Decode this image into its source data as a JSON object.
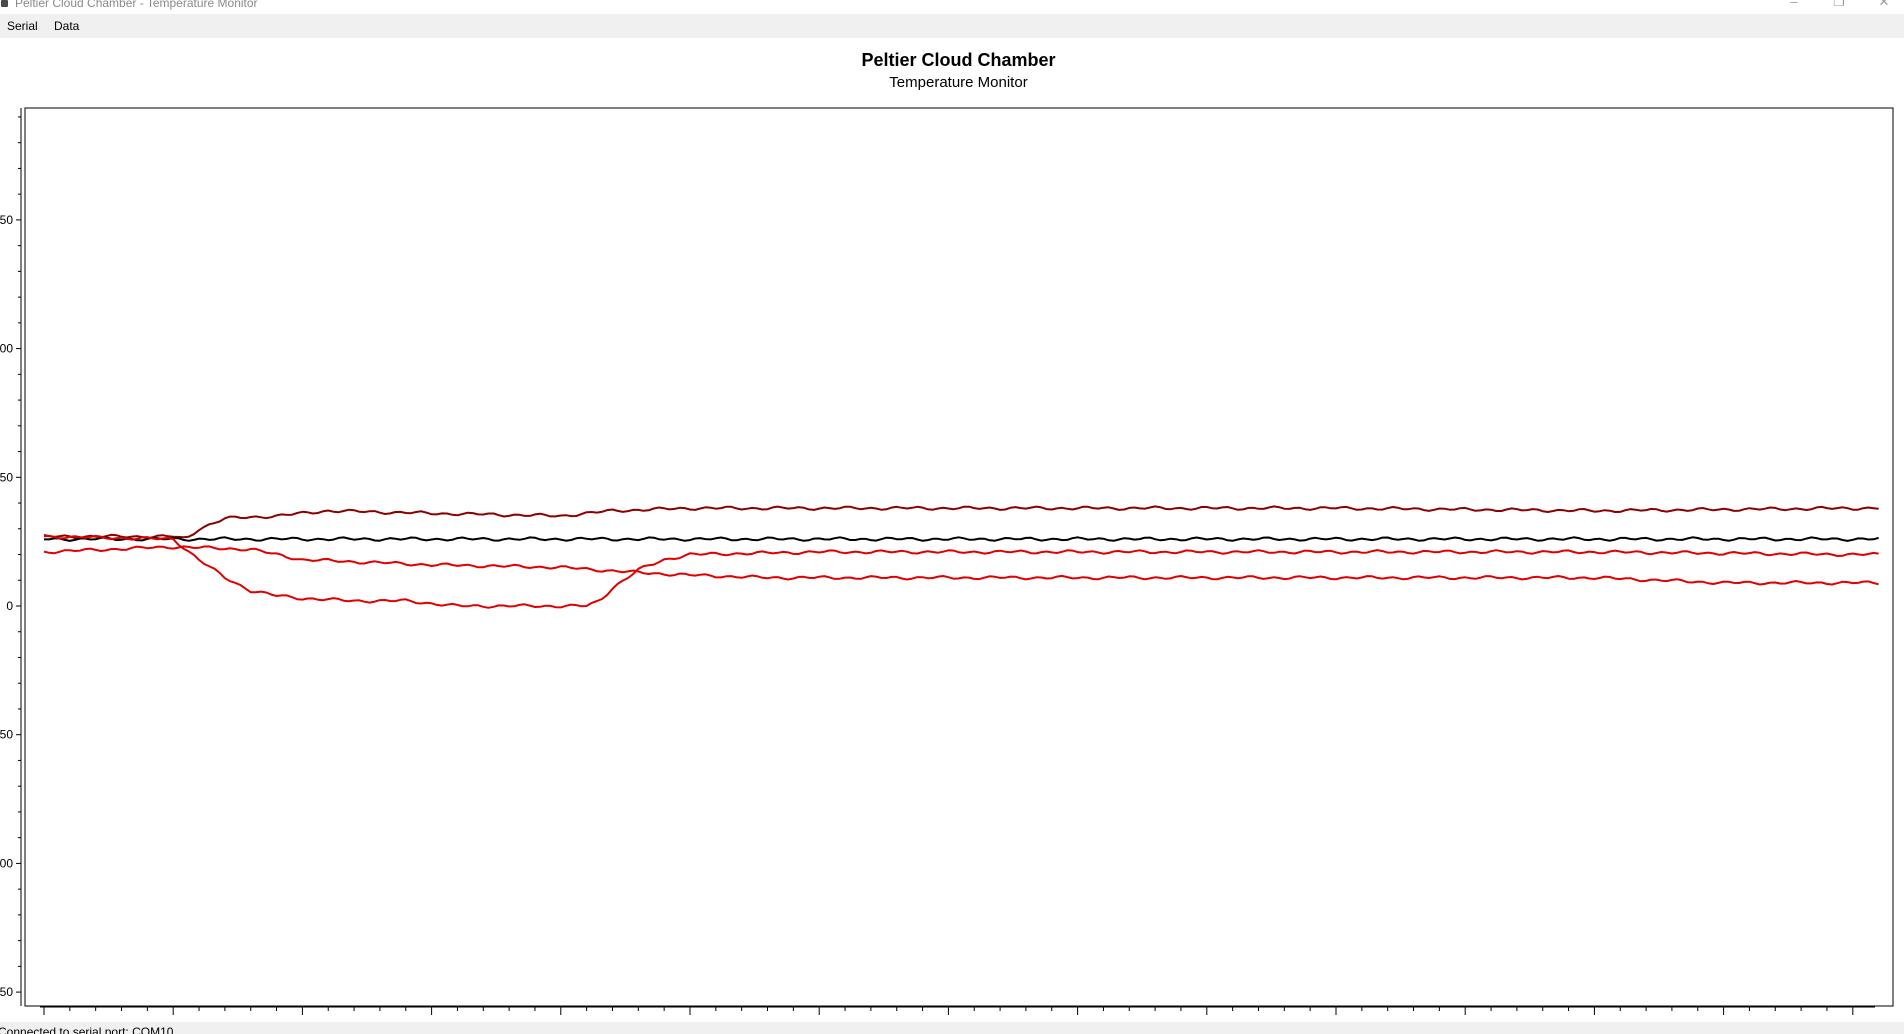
{
  "window": {
    "title": "Peltier Cloud Chamber - Temperature Monitor",
    "minimize_glyph": "–",
    "maximize_glyph": "❐",
    "close_glyph": "✕"
  },
  "menu": {
    "items": [
      {
        "label": "Serial"
      },
      {
        "label": "Data"
      }
    ]
  },
  "status": {
    "text": "Connected to serial port: COM10"
  },
  "colors": {
    "series_dark_red": "#8b0000",
    "series_black": "#000000",
    "series_red": "#e00000",
    "axis": "#000000"
  },
  "chart_data": {
    "type": "line",
    "title": "Peltier Cloud Chamber",
    "subtitle": "Temperature Monitor",
    "ylim": [
      -150,
      200
    ],
    "yticks": [
      -150,
      -100,
      -50,
      0,
      50,
      100,
      150
    ],
    "ytick_labels": [
      "50",
      "00",
      "50",
      "0",
      "50",
      "00",
      "50"
    ],
    "xlim": [
      0,
      720
    ],
    "x_major_step": 50,
    "x_minor_step": 10,
    "grid": false,
    "legend": "none",
    "series": [
      {
        "color": "#8b0000",
        "x": [
          0,
          50,
          55,
          60,
          70,
          90,
          110,
          150,
          200,
          220,
          250,
          300,
          400,
          500,
          600,
          700,
          710
        ],
        "y": [
          27,
          27,
          26,
          30,
          34,
          35,
          37,
          36,
          35,
          37,
          38,
          38,
          38,
          38,
          37,
          38,
          38
        ]
      },
      {
        "color": "#000000",
        "x": [
          0,
          50,
          100,
          200,
          300,
          400,
          500,
          600,
          700,
          710
        ],
        "y": [
          26,
          26,
          26,
          26,
          26,
          26,
          26,
          26,
          26,
          26
        ]
      },
      {
        "color": "#e00000",
        "x": [
          0,
          50,
          55,
          60,
          70,
          80,
          90,
          100,
          120,
          140,
          160,
          180,
          200,
          210,
          215,
          220,
          230,
          240,
          250,
          300,
          400,
          500,
          600,
          700,
          710
        ],
        "y": [
          27,
          26,
          22,
          18,
          11,
          6,
          4,
          3,
          2,
          2,
          0,
          0,
          0,
          0,
          2,
          7,
          14,
          18,
          20,
          21,
          21,
          21,
          21,
          20,
          20
        ]
      },
      {
        "color": "#e00000",
        "x": [
          0,
          50,
          80,
          100,
          150,
          200,
          230,
          250,
          280,
          300,
          400,
          500,
          600,
          650,
          700,
          710
        ],
        "y": [
          21,
          23,
          22,
          18,
          16,
          15,
          13,
          12,
          11,
          11,
          11,
          11,
          11,
          9,
          9,
          9
        ]
      }
    ]
  }
}
